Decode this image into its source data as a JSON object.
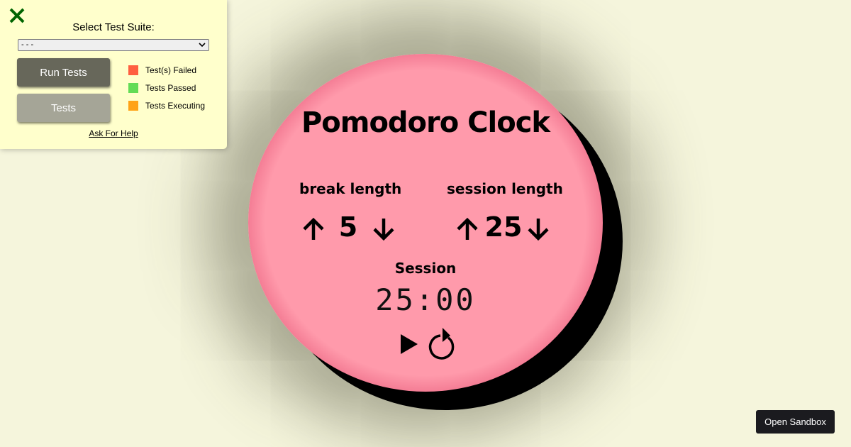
{
  "clock": {
    "title": "Pomodoro Clock",
    "break_label": "break length",
    "session_label": "session length",
    "break_length": "5",
    "session_length": "25",
    "timer_label": "Session",
    "time_left": "25:00",
    "icons": {
      "break_increment": "arrow-up-icon",
      "break_decrement": "arrow-down-icon",
      "session_increment": "arrow-up-icon",
      "session_decrement": "arrow-down-icon",
      "start_stop": "play-icon",
      "reset": "refresh-icon"
    },
    "colors": {
      "face_center": "#ff9aab",
      "face_edge": "#a80f42",
      "shadow": "#000000"
    }
  },
  "test_panel": {
    "close_icon": "close-x-icon",
    "suite_label": "Select Test Suite:",
    "suite_selected": "- - -",
    "run_tests_label": "Run Tests",
    "tests_label": "Tests",
    "legend": [
      {
        "label": "Test(s) Failed",
        "color": "#ff5f3f"
      },
      {
        "label": "Tests Passed",
        "color": "#63dc56"
      },
      {
        "label": "Tests Executing",
        "color": "#ffa317"
      }
    ],
    "help_link": "Ask For Help",
    "colors": {
      "panel_bg": "#ffffcc",
      "close_icon": "#006400",
      "run_tests_bg": "#67675a",
      "tests_bg": "#a5a597"
    }
  },
  "sandbox": {
    "label": "Open Sandbox"
  },
  "page": {
    "background": "#f5f5dc"
  }
}
